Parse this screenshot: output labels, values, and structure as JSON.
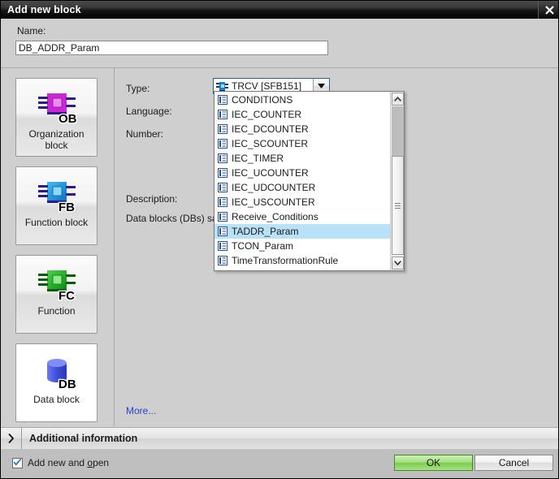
{
  "window": {
    "title": "Add new block",
    "close_icon": "close-icon"
  },
  "name_section": {
    "label": "Name:",
    "value": "DB_ADDR_Param"
  },
  "block_types": [
    {
      "id": "ob",
      "caption": "Organization\nblock",
      "line1": "Organization",
      "line2": "block",
      "badge": "OB",
      "color": "#cc26d4",
      "selected": false
    },
    {
      "id": "fb",
      "caption": "Function block",
      "line1": "Function block",
      "line2": "",
      "badge": "FB",
      "color": "#1f9fe0",
      "selected": false
    },
    {
      "id": "fc",
      "caption": "Function",
      "line1": "Function",
      "line2": "",
      "badge": "FC",
      "color": "#22b324",
      "selected": false
    },
    {
      "id": "db",
      "caption": "Data block",
      "line1": "Data block",
      "line2": "",
      "badge": "DB",
      "color": "#4a56d8",
      "selected": true
    }
  ],
  "form": {
    "type_label": "Type:",
    "language_label": "Language:",
    "number_label": "Number:",
    "description_label": "Description:",
    "db_info_label": "Data blocks (DBs) sa",
    "more_link": "More..."
  },
  "type_combo": {
    "value": "TRCV  [SFB151]",
    "icon": "function-block-icon",
    "arrow_icon": "chevron-down-icon"
  },
  "dropdown": {
    "items": [
      {
        "label": "CONDITIONS",
        "selected": false
      },
      {
        "label": "IEC_COUNTER",
        "selected": false
      },
      {
        "label": "IEC_DCOUNTER",
        "selected": false
      },
      {
        "label": "IEC_SCOUNTER",
        "selected": false
      },
      {
        "label": "IEC_TIMER",
        "selected": false
      },
      {
        "label": "IEC_UCOUNTER",
        "selected": false
      },
      {
        "label": "IEC_UDCOUNTER",
        "selected": false
      },
      {
        "label": "IEC_USCOUNTER",
        "selected": false
      },
      {
        "label": "Receive_Conditions",
        "selected": false
      },
      {
        "label": "TADDR_Param",
        "selected": true
      },
      {
        "label": "TCON_Param",
        "selected": false
      },
      {
        "label": "TimeTransformationRule",
        "selected": false
      }
    ],
    "scrollbar": {
      "up_icon": "scroll-up-icon",
      "down_icon": "scroll-down-icon"
    },
    "item_icon": "data-type-icon",
    "highlight_color": "#b9e1f7"
  },
  "additional_information": {
    "label": "Additional  information",
    "expander_icon": "chevron-right-icon"
  },
  "footer": {
    "checkbox_label_pre": "Add new and ",
    "checkbox_label_underlined": "o",
    "checkbox_label_post": "pen",
    "checkbox_checked": true,
    "ok_label": "OK",
    "cancel_label": "Cancel",
    "ok_color": "#7ecb4e"
  }
}
